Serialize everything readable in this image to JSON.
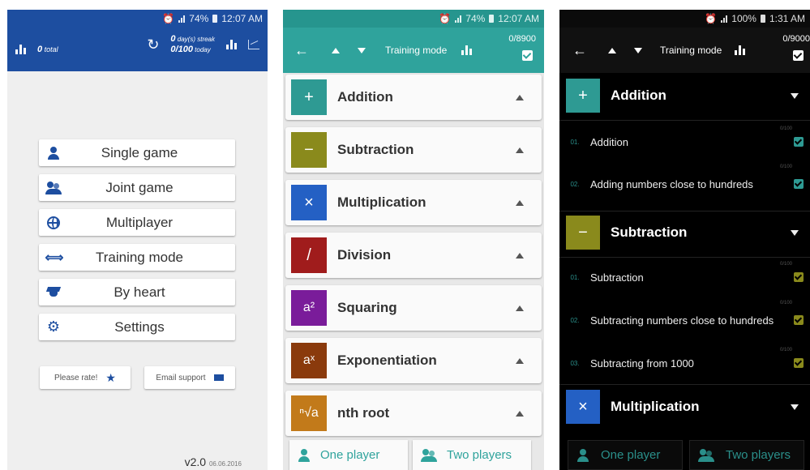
{
  "phone1": {
    "status": {
      "battery": "74%",
      "time": "12:07 AM"
    },
    "toolbar": {
      "total_value": "0",
      "total_label": "total",
      "streak_value": "0",
      "streak_label": "day(s) streak",
      "today_value": "0/100",
      "today_label": "today"
    },
    "menu": [
      {
        "label": "Single game",
        "icon": "person-icon"
      },
      {
        "label": "Joint game",
        "icon": "people-icon"
      },
      {
        "label": "Multiplayer",
        "icon": "globe-icon"
      },
      {
        "label": "Training mode",
        "icon": "dumbbell-icon"
      },
      {
        "label": "By heart",
        "icon": "graduation-cap-icon"
      },
      {
        "label": "Settings",
        "icon": "gear-icon"
      }
    ],
    "rate_label": "Please rate!",
    "email_label": "Email support",
    "version": "v2.0",
    "version_date": "06.06.2016"
  },
  "phone2": {
    "status": {
      "battery": "74%",
      "time": "12:07 AM"
    },
    "toolbar": {
      "title": "Training mode",
      "count": "0/8900"
    },
    "categories": [
      {
        "label": "Addition",
        "symbol": "+",
        "color": "#2e9a93"
      },
      {
        "label": "Subtraction",
        "symbol": "−",
        "color": "#8a8a1c"
      },
      {
        "label": "Multiplication",
        "symbol": "×",
        "color": "#2460c4"
      },
      {
        "label": "Division",
        "symbol": "/",
        "color": "#a01c1c"
      },
      {
        "label": "Squaring",
        "symbol": "a²",
        "color": "#7a1c9a"
      },
      {
        "label": "Exponentiation",
        "symbol": "aˣ",
        "color": "#8a3a0c"
      },
      {
        "label": "nth root",
        "symbol": "ⁿ√a",
        "color": "#c27a1a"
      }
    ],
    "bottom": {
      "one_player": "One player",
      "two_players": "Two players"
    }
  },
  "phone3": {
    "status": {
      "battery": "100%",
      "time": "1:31 AM"
    },
    "toolbar": {
      "title": "Training mode",
      "count": "0/9000"
    },
    "sections": [
      {
        "label": "Addition",
        "symbol": "+",
        "color": "#2e9a93"
      },
      {
        "label": "Subtraction",
        "symbol": "−",
        "color": "#8a8a1c"
      },
      {
        "label": "Multiplication",
        "symbol": "×",
        "color": "#2460c4"
      }
    ],
    "items": [
      {
        "num": "01.",
        "text": "Addition",
        "progress": "0/100",
        "color": "#2e9a93"
      },
      {
        "num": "02.",
        "text": "Adding numbers close to hundreds",
        "progress": "0/100",
        "color": "#2e9a93"
      },
      {
        "num": "01.",
        "text": "Subtraction",
        "progress": "0/100",
        "color": "#8a8a1c"
      },
      {
        "num": "02.",
        "text": "Subtracting numbers close to hundreds",
        "progress": "0/100",
        "color": "#8a8a1c"
      },
      {
        "num": "03.",
        "text": "Subtracting from 1000",
        "progress": "0/100",
        "color": "#8a8a1c"
      }
    ],
    "bottom": {
      "one_player": "One player",
      "two_players": "Two players"
    }
  }
}
